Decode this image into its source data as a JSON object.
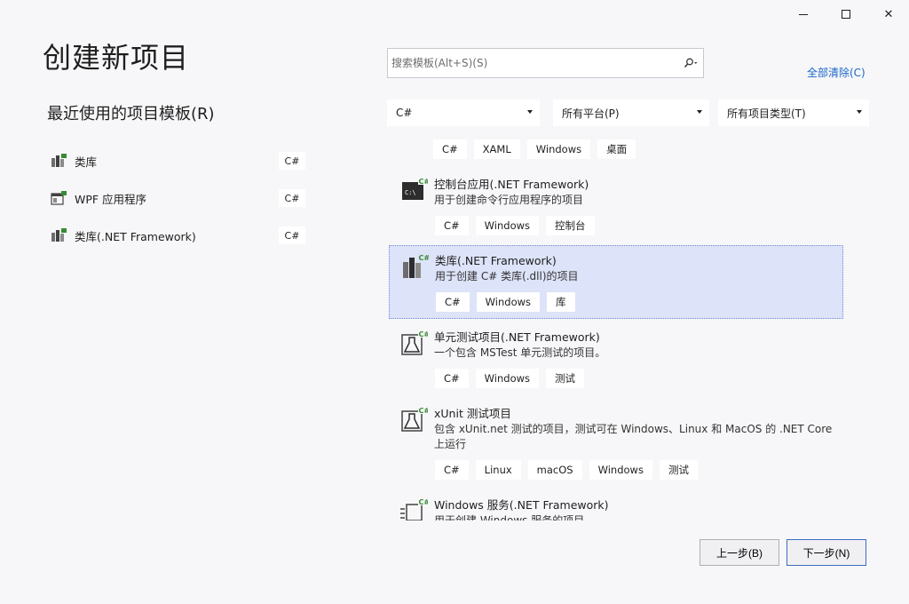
{
  "window": {
    "minimize": "minimize-icon",
    "maximize": "maximize-icon",
    "close_glyph": "✕"
  },
  "page_title": "创建新项目",
  "recent": {
    "title": "最近使用的项目模板(R)",
    "items": [
      {
        "label": "类库",
        "lang": "C#",
        "icon": "class-library-icon"
      },
      {
        "label": "WPF 应用程序",
        "lang": "C#",
        "icon": "wpf-app-icon"
      },
      {
        "label": "类库(.NET Framework)",
        "lang": "C#",
        "icon": "class-library-icon"
      }
    ]
  },
  "search": {
    "placeholder": "搜索模板(Alt+S)(S)",
    "value": ""
  },
  "clear_all": "全部清除(C)",
  "filters": {
    "language": "C#",
    "platform": "所有平台(P)",
    "project_type": "所有项目类型(T)"
  },
  "templates": {
    "top_tags": [
      "C#",
      "XAML",
      "Windows",
      "桌面"
    ],
    "items": [
      {
        "name": "控制台应用(.NET Framework)",
        "desc": "用于创建命令行应用程序的项目",
        "tags": [
          "C#",
          "Windows",
          "控制台"
        ]
      },
      {
        "name": "类库(.NET Framework)",
        "desc": "用于创建 C# 类库(.dll)的项目",
        "tags": [
          "C#",
          "Windows",
          "库"
        ]
      },
      {
        "name": "单元测试项目(.NET Framework)",
        "desc": "一个包含 MSTest 单元测试的项目。",
        "tags": [
          "C#",
          "Windows",
          "测试"
        ]
      },
      {
        "name": "xUnit 测试项目",
        "desc": "包含 xUnit.net 测试的项目，测试可在 Windows、Linux 和 MacOS 的 .NET Core 上运行",
        "tags": [
          "C#",
          "Linux",
          "macOS",
          "Windows",
          "测试"
        ]
      },
      {
        "name": "Windows 服务(.NET Framework)",
        "desc": "用于创建 Windows 服务的项目",
        "tags": []
      }
    ]
  },
  "buttons": {
    "back": "上一步(B)",
    "next": "下一步(N)"
  },
  "colors": {
    "accent": "#1a66c7",
    "selected_bg": "#dde3f8",
    "csharp_badge": "#388a34"
  }
}
